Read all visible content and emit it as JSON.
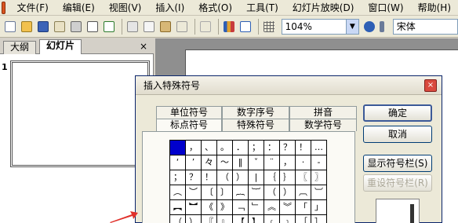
{
  "menubar": {
    "items": [
      "文件(F)",
      "编辑(E)",
      "视图(V)",
      "插入(I)",
      "格式(O)",
      "工具(T)",
      "幻灯片放映(D)",
      "窗口(W)",
      "帮助(H)"
    ]
  },
  "toolbar": {
    "zoom": "104%",
    "font": "宋体",
    "icons": [
      "new-icon",
      "open-icon",
      "save-icon",
      "email-icon",
      "print-icon",
      "preview-icon",
      "spellcheck-icon",
      "cut-icon",
      "copy-icon",
      "paste-icon",
      "format-painter-icon",
      "undo-icon",
      "chart-icon",
      "table-icon",
      "grid-icon",
      "help-icon",
      "toolbar-options-icon"
    ]
  },
  "pane": {
    "tab_outline": "大纲",
    "tab_slides": "幻灯片",
    "close": "×",
    "slide_number": "1"
  },
  "dialog": {
    "title": "插入特殊符号",
    "close": "×",
    "tabs_back": [
      "单位符号",
      "数字序号",
      "拼音"
    ],
    "tabs_front": [
      "标点符号",
      "特殊符号",
      "数学符号"
    ],
    "active_tab": "标点符号",
    "symbols": [
      [
        "",
        "，",
        "、",
        "。",
        "．",
        "；",
        "：",
        "？",
        "！",
        "…"
      ],
      [
        "‘",
        "’",
        "々",
        "～",
        "‖",
        "ˇ",
        "¨",
        "，",
        "·",
        "-"
      ],
      [
        "；",
        "？",
        "！",
        "（",
        "）",
        "|",
        "｛",
        "｝",
        "〖",
        "〗"
      ],
      [
        "︵",
        "︶",
        "〔",
        "〕",
        "︷",
        "︸",
        "（",
        "）",
        "︹",
        "︺"
      ],
      [
        "︻",
        "︼",
        "《",
        "》",
        "﹁",
        "﹂",
        "︽",
        "︾",
        "「",
        "」"
      ],
      [
        "（",
        "）",
        "『",
        "』",
        "【",
        "】",
        "﹝",
        "﹞",
        "［",
        "］"
      ]
    ],
    "buttons": {
      "ok": "确定",
      "cancel": "取消",
      "show_bar": "显示符号栏(S)",
      "reset_bar": "重设符号栏(R)"
    }
  },
  "colors": {
    "selected_symbol": "#0000cc",
    "arrow": "#e0302a"
  }
}
